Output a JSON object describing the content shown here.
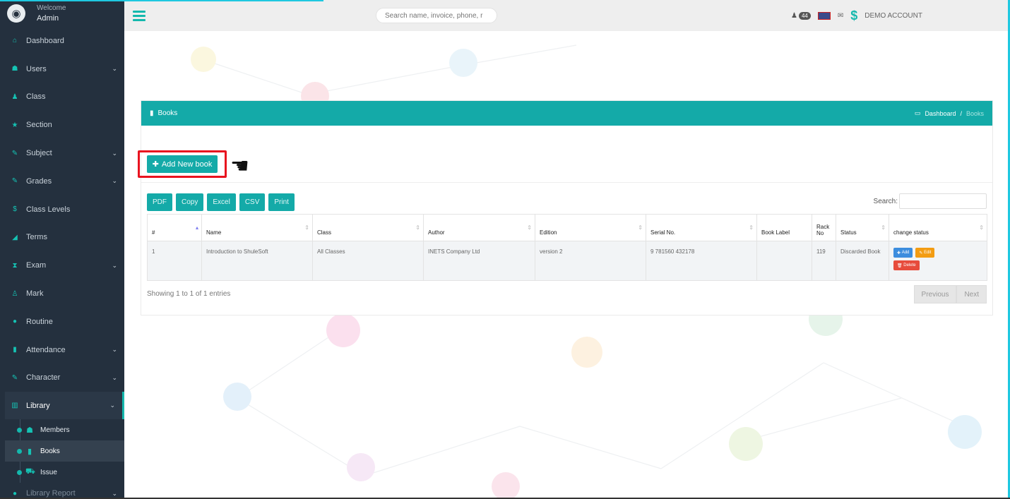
{
  "sidebar": {
    "welcome": "Welcome",
    "user": "Admin",
    "items": [
      {
        "label": "Dashboard",
        "icon": "home-icon",
        "glyph": "⌂",
        "chev": ""
      },
      {
        "label": "Users",
        "icon": "users-icon",
        "glyph": "☗",
        "chev": "⌄"
      },
      {
        "label": "Class",
        "icon": "class-icon",
        "glyph": "♟",
        "chev": ""
      },
      {
        "label": "Section",
        "icon": "star-icon",
        "glyph": "★",
        "chev": ""
      },
      {
        "label": "Subject",
        "icon": "edit-icon",
        "glyph": "✎",
        "chev": "⌄"
      },
      {
        "label": "Grades",
        "icon": "edit-icon",
        "glyph": "✎",
        "chev": "⌄"
      },
      {
        "label": "Class Levels",
        "icon": "dollar-icon",
        "glyph": "$",
        "chev": ""
      },
      {
        "label": "Terms",
        "icon": "chart-icon",
        "glyph": "◢",
        "chev": ""
      },
      {
        "label": "Exam",
        "icon": "hourglass-icon",
        "glyph": "⧗",
        "chev": "⌄"
      },
      {
        "label": "Mark",
        "icon": "flask-icon",
        "glyph": "♙",
        "chev": ""
      },
      {
        "label": "Routine",
        "icon": "clock-icon",
        "glyph": "●",
        "chev": ""
      },
      {
        "label": "Attendance",
        "icon": "clipboard-icon",
        "glyph": "▮",
        "chev": "⌄"
      },
      {
        "label": "Character",
        "icon": "edit-icon",
        "glyph": "✎",
        "chev": "⌄"
      }
    ],
    "library": {
      "label": "Library",
      "glyph": "▥",
      "chev": "⌄"
    },
    "sub_items": [
      {
        "label": "Members",
        "glyph": "☗"
      },
      {
        "label": "Books",
        "glyph": "▮"
      },
      {
        "label": "Issue",
        "glyph": "⛟"
      }
    ],
    "last_item": {
      "label": "Library Report",
      "chev": "⌄"
    }
  },
  "topbar": {
    "search_placeholder": "Search name, invoice, phone, r",
    "notif_count": "44",
    "account": "DEMO ACCOUNT"
  },
  "panel": {
    "title": "Books",
    "breadcrumb_home": "Dashboard",
    "breadcrumb_sep": "/",
    "breadcrumb_current": "Books"
  },
  "add_button": "Add New book",
  "exports": [
    "PDF",
    "Copy",
    "Excel",
    "CSV",
    "Print"
  ],
  "search_label": "Search:",
  "table": {
    "headers": [
      "#",
      "Name",
      "Class",
      "Author",
      "Edition",
      "Serial No.",
      "Book Label",
      "Rack No",
      "Status",
      "change status"
    ],
    "rows": [
      {
        "num": "1",
        "name": "Introduction to ShuleSoft",
        "class": "All Classes",
        "author": "INETS Company Ltd",
        "edition": "version 2",
        "serial": "9 781560 432178",
        "label": "",
        "rack": "119",
        "status": "Discarded Book",
        "add": "Add",
        "edit": "Edit",
        "del": "Delete"
      }
    ]
  },
  "info": "Showing 1 to 1 of 1 entries",
  "pager": {
    "prev": "Previous",
    "next": "Next"
  }
}
